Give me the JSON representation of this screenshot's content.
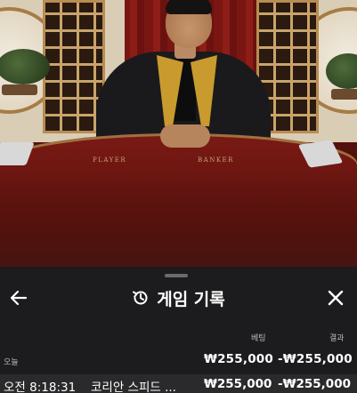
{
  "video": {
    "table_labels": {
      "player": "PLAYER",
      "banker": "BANKER"
    }
  },
  "sheet": {
    "title": "게임 기록",
    "title_icon": "history-icon",
    "back_icon": "arrow-left-icon",
    "close_icon": "close-icon",
    "columns": {
      "bet": "베팅",
      "result": "결과"
    },
    "sections": [
      {
        "label": "오늘",
        "total_bet": "₩255,000",
        "total_result": "-₩255,000",
        "rows": [
          {
            "time": "오전 8:18:31",
            "game": "코리안 스피드 ...",
            "bet": "₩255,000",
            "result": "-₩255,000"
          }
        ]
      }
    ]
  }
}
